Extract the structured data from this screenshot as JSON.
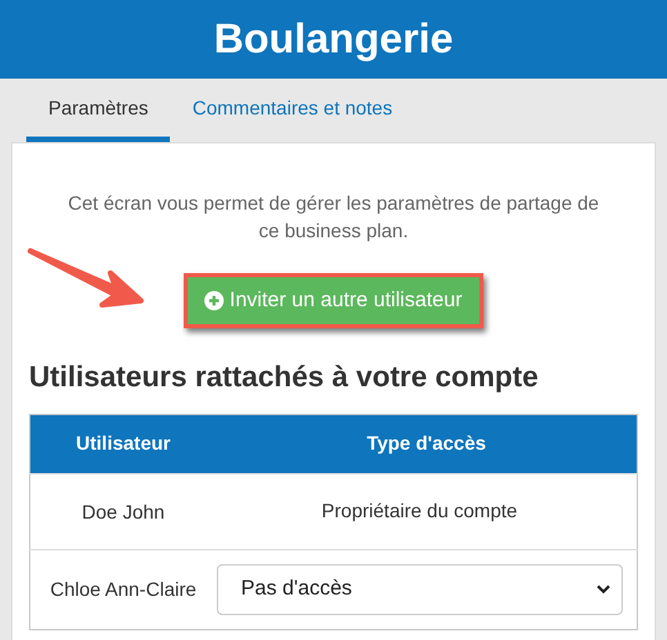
{
  "header": {
    "title": "Boulangerie"
  },
  "tabs": [
    {
      "label": "Paramètres",
      "selected": true
    },
    {
      "label": "Commentaires et notes",
      "selected": false
    }
  ],
  "intro": "Cet écran vous permet de gérer les paramètres de partage de ce business plan.",
  "invite_button": {
    "label": "Inviter un autre utilisateur",
    "highlighted": true
  },
  "section_title": "Utilisateurs rattachés à votre compte",
  "table": {
    "columns": [
      "Utilisateur",
      "Type d'accès"
    ],
    "rows": [
      {
        "user": "Doe John",
        "access": {
          "kind": "text",
          "text": "Propriétaire du compte"
        }
      },
      {
        "user": "Chloe Ann-Claire",
        "access": {
          "kind": "select",
          "value": "Pas d'accès"
        }
      }
    ]
  }
}
